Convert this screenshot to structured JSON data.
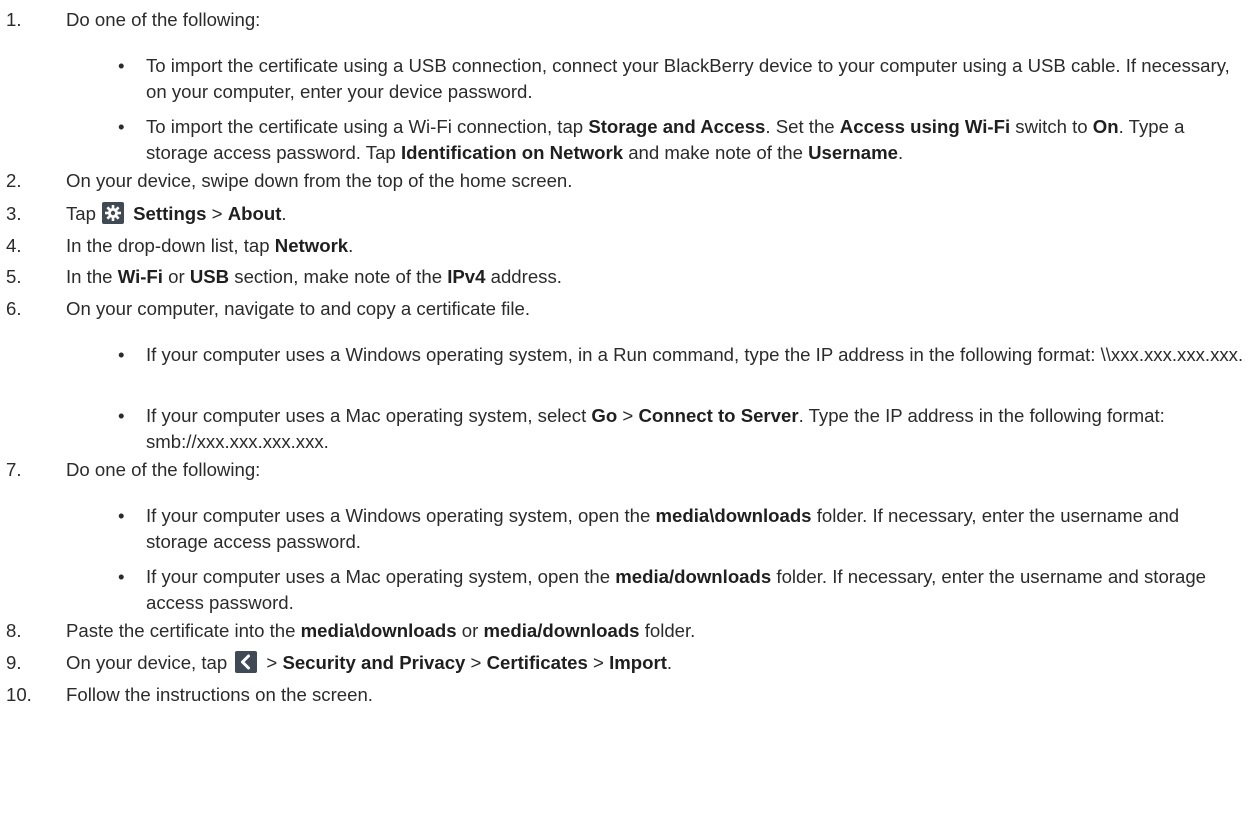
{
  "steps": [
    {
      "num": "1.",
      "text": "Do one of the following:"
    },
    {
      "num": "2.",
      "text": "On your device, swipe down from the top of the home screen."
    },
    {
      "num": "3.",
      "pre": "Tap",
      "bold1": "Settings",
      "sep": " > ",
      "bold2": "About",
      "post": "."
    },
    {
      "num": "4.",
      "pre": "In the drop-down list, tap ",
      "bold": "Network",
      "post": "."
    },
    {
      "num": "5.",
      "pre": "In the ",
      "bold1": "Wi-Fi",
      "mid1": " or ",
      "bold2": "USB",
      "mid2": " section, make note of the ",
      "bold3": "IPv4",
      "post": " address."
    },
    {
      "num": "6.",
      "text": "On your computer, navigate to and copy a certificate file."
    },
    {
      "num": "7.",
      "text": "Do one of the following:"
    },
    {
      "num": "8.",
      "pre": "Paste the certificate into the ",
      "bold1": "media\\downloads",
      "mid": " or ",
      "bold2": "media/downloads",
      "post": " folder."
    },
    {
      "num": "9.",
      "pre": "On your device, tap",
      "sep1": " > ",
      "bold1": "Security and Privacy",
      "sep2": " > ",
      "bold2": "Certificates",
      "sep3": " > ",
      "bold3": "Import",
      "post": "."
    },
    {
      "num": "10.",
      "text": "Follow the instructions on the screen."
    }
  ],
  "bullets": {
    "b1a": {
      "text": "To import the certificate using a USB connection, connect your BlackBerry device to your computer using a USB cable. If necessary, on your computer, enter your device password."
    },
    "b1b": {
      "t1": "To import the certificate using a Wi-Fi connection, tap ",
      "b1": "Storage and Access",
      "t2": ". Set the ",
      "b2": "Access using Wi-Fi",
      "t3": " switch to ",
      "b3": "On",
      "t4": ". Type a storage access password. Tap ",
      "b4": "Identification on Network",
      "t5": " and make note of the ",
      "b5": "Username",
      "t6": "."
    },
    "b6a": {
      "text": "If your computer uses a Windows operating system, in a Run command, type the IP address in the following format: \\\\xxx.xxx.xxx.xxx."
    },
    "b6b": {
      "t1": "If your computer uses a Mac operating system, select ",
      "b1": "Go",
      "t2": " > ",
      "b2": "Connect to Server",
      "t3": ". Type the IP address in the following format: smb://xxx.xxx.xxx.xxx."
    },
    "b7a": {
      "t1": "If your computer uses a Windows operating system, open the ",
      "b1": "media\\downloads",
      "t2": " folder. If necessary, enter the username and storage access password."
    },
    "b7b": {
      "t1": "If your computer uses a Mac operating system, open the ",
      "b1": "media/downloads",
      "t2": " folder. If necessary, enter the username and storage access password."
    }
  },
  "bullet_char": "•",
  "icons": {
    "settings": "gear-icon",
    "back": "chevron-left-icon",
    "color": "#3f4a55"
  }
}
